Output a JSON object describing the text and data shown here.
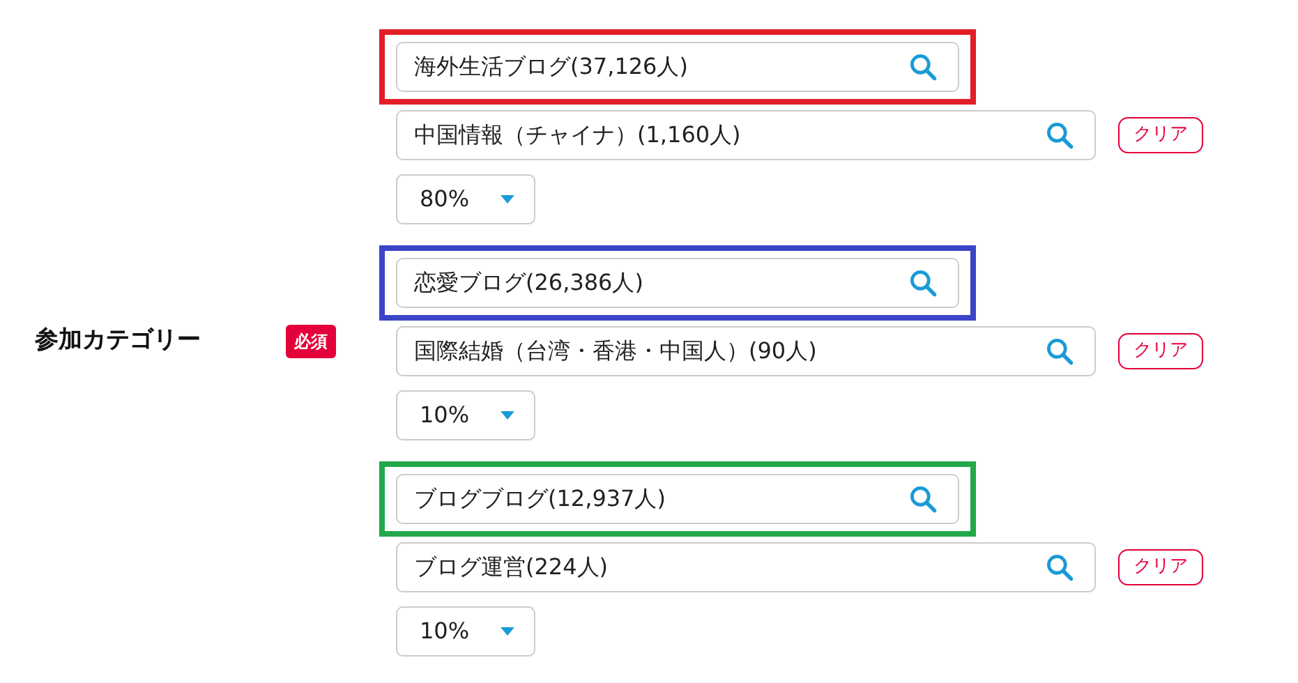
{
  "field": {
    "label": "参加カテゴリー",
    "badge": "必須"
  },
  "groups": [
    {
      "color": "#e21d28",
      "primary": "海外生活ブログ(37,126人)",
      "secondary": "中国情報（チャイナ）(1,160人)",
      "clear": "クリア",
      "ratio": "80%"
    },
    {
      "color": "#3c44c8",
      "primary": "恋愛ブログ(26,386人)",
      "secondary": "国際結婚（台湾・香港・中国人）(90人)",
      "clear": "クリア",
      "ratio": "10%"
    },
    {
      "color": "#22a84a",
      "primary": "ブログブログ(12,937人)",
      "secondary": "ブログ運営(224人)",
      "clear": "クリア",
      "ratio": "10%"
    }
  ]
}
